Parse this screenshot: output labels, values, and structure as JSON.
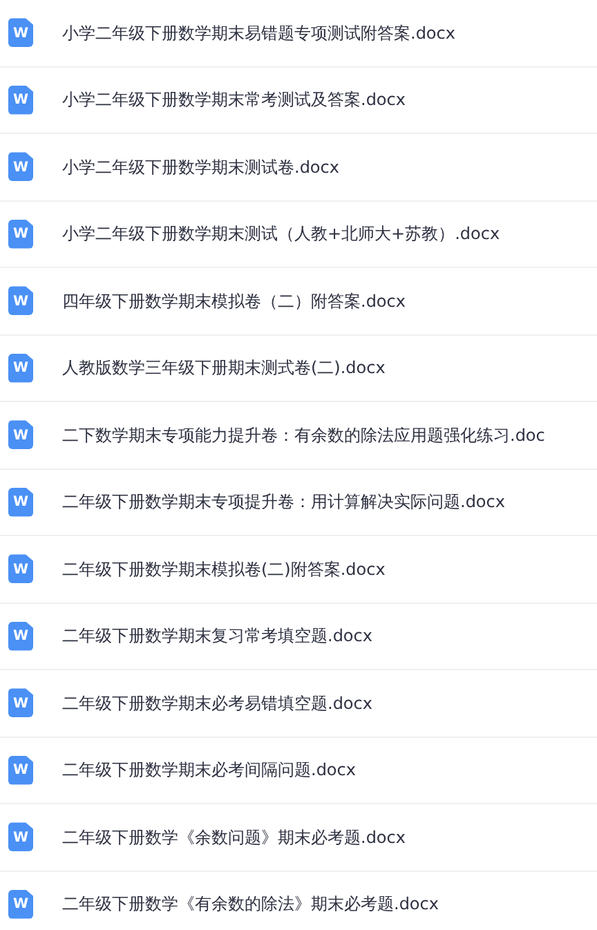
{
  "files": [
    {
      "icon_letter": "W",
      "name": "小学二年级下册数学期末易错题专项测试附答案.docx"
    },
    {
      "icon_letter": "W",
      "name": "小学二年级下册数学期末常考测试及答案.docx"
    },
    {
      "icon_letter": "W",
      "name": "小学二年级下册数学期末测试卷.docx"
    },
    {
      "icon_letter": "W",
      "name": "小学二年级下册数学期末测试（人教+北师大+苏教）.docx"
    },
    {
      "icon_letter": "W",
      "name": "四年级下册数学期末模拟卷（二）附答案.docx"
    },
    {
      "icon_letter": "W",
      "name": "人教版数学三年级下册期末测式卷(二).docx"
    },
    {
      "icon_letter": "W",
      "name": "二下数学期末专项能力提升卷：有余数的除法应用题强化练习.doc"
    },
    {
      "icon_letter": "W",
      "name": "二年级下册数学期末专项提升卷：用计算解决实际问题.docx"
    },
    {
      "icon_letter": "W",
      "name": "二年级下册数学期末模拟卷(二)附答案.docx"
    },
    {
      "icon_letter": "W",
      "name": "二年级下册数学期末复习常考填空题.docx"
    },
    {
      "icon_letter": "W",
      "name": "二年级下册数学期末必考易错填空题.docx"
    },
    {
      "icon_letter": "W",
      "name": "二年级下册数学期末必考间隔问题.docx"
    },
    {
      "icon_letter": "W",
      "name": "二年级下册数学《余数问题》期末必考题.docx"
    },
    {
      "icon_letter": "W",
      "name": "二年级下册数学《有余数的除法》期末必考题.docx"
    }
  ]
}
